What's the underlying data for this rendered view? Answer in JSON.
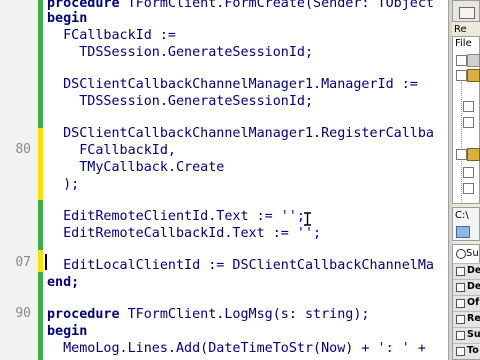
{
  "editor": {
    "gutter_numbers": {
      "n80": "80",
      "n07": "07",
      "n90": "90"
    },
    "lines": {
      "l0_a": "procedure",
      "l0_b": " TFormClient.FormCreate(Sender: TObject",
      "l1": "begin",
      "l2": "  FCallbackId :=",
      "l3": "    TDSSession.GenerateSessionId;",
      "l5": "  DSClientCallbackChannelManager1.ManagerId :=",
      "l6": "    TDSSession.GenerateSessionId;",
      "l8": "  DSClientCallbackChannelManager1.RegisterCallba",
      "l9": "    FCallbackId,",
      "l10": "    TMyCallback.Create",
      "l11": "  );",
      "l13_a": "  EditRemoteClientId.Text := ",
      "l13_b": "'';",
      "l14_a": "  EditRemoteCallbackId.Text := ",
      "l14_b": "'';",
      "l16": "  EditLocalClientId := DSClientCallbackChannelMa",
      "l17": "end;",
      "l19_a": "procedure",
      "l19_b": " TFormClient.LogMsg(s: string);",
      "l20": "begin",
      "l21_a": "  MemoLog.Lines.Add(DateTimeToStr(Now) + ",
      "l21_b": "': '",
      "l21_c": " +"
    }
  },
  "side_panel": {
    "top_label": "Re",
    "file_label": "File",
    "c_label": "C:\\",
    "items": [
      "De",
      "De",
      "Of",
      "Re",
      "Su",
      "To"
    ],
    "search_label": "Su"
  }
}
